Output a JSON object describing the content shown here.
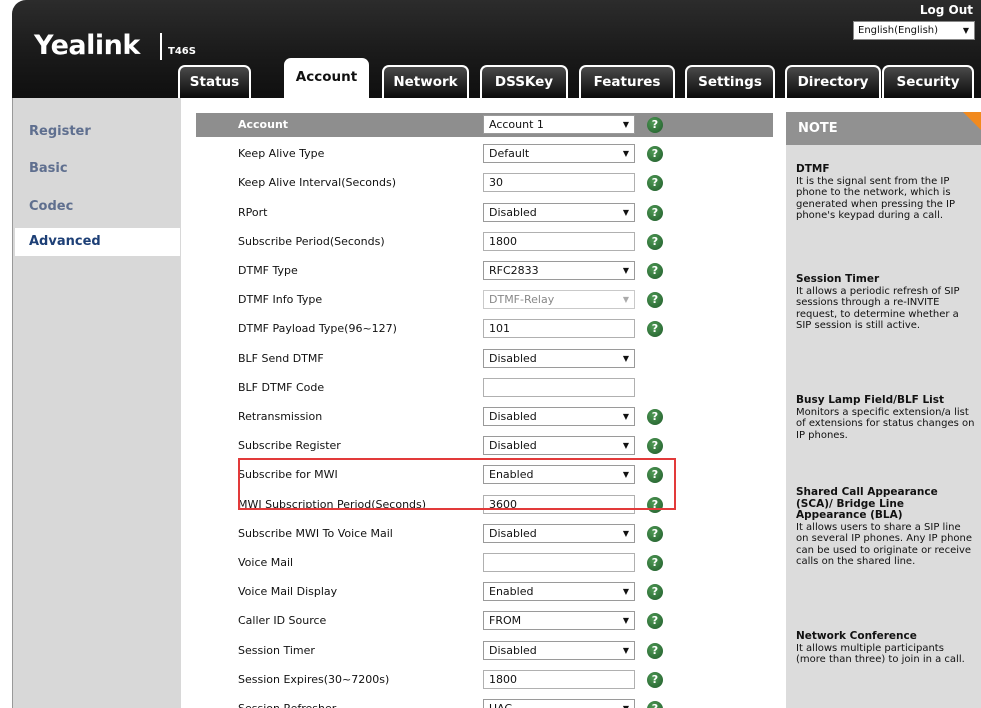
{
  "header": {
    "logo": "Yealink",
    "model": "T46S",
    "logout": "Log Out",
    "language": "English(English)",
    "tabs": [
      "Status",
      "Account",
      "Network",
      "DSSKey",
      "Features",
      "Settings",
      "Directory",
      "Security"
    ],
    "active_tab": "Account"
  },
  "sidebar": {
    "items": [
      "Register",
      "Basic",
      "Codec",
      "Advanced"
    ],
    "active": "Advanced"
  },
  "form": {
    "rows": [
      {
        "label": "Account",
        "type": "select",
        "value": "Account 1",
        "help": true
      },
      {
        "label": "Keep Alive Type",
        "type": "select",
        "value": "Default",
        "help": true
      },
      {
        "label": "Keep Alive Interval(Seconds)",
        "type": "input",
        "value": "30",
        "help": true
      },
      {
        "label": "RPort",
        "type": "select",
        "value": "Disabled",
        "help": true
      },
      {
        "label": "Subscribe Period(Seconds)",
        "type": "input",
        "value": "1800",
        "help": true
      },
      {
        "label": "DTMF Type",
        "type": "select",
        "value": "RFC2833",
        "help": true
      },
      {
        "label": "DTMF Info Type",
        "type": "select",
        "value": "DTMF-Relay",
        "help": true,
        "disabled": true
      },
      {
        "label": "DTMF Payload Type(96~127)",
        "type": "input",
        "value": "101",
        "help": true
      },
      {
        "label": "BLF Send DTMF",
        "type": "select",
        "value": "Disabled",
        "help": false
      },
      {
        "label": "BLF DTMF Code",
        "type": "input",
        "value": "",
        "help": false
      },
      {
        "label": "Retransmission",
        "type": "select",
        "value": "Disabled",
        "help": true
      },
      {
        "label": "Subscribe Register",
        "type": "select",
        "value": "Disabled",
        "help": true
      },
      {
        "label": "Subscribe for MWI",
        "type": "select",
        "value": "Enabled",
        "help": true
      },
      {
        "label": "MWI Subscription Period(Seconds)",
        "type": "input",
        "value": "3600",
        "help": true
      },
      {
        "label": "Subscribe MWI To Voice Mail",
        "type": "select",
        "value": "Disabled",
        "help": true
      },
      {
        "label": "Voice Mail",
        "type": "input",
        "value": "",
        "help": true
      },
      {
        "label": "Voice Mail Display",
        "type": "select",
        "value": "Enabled",
        "help": true
      },
      {
        "label": "Caller ID Source",
        "type": "select",
        "value": "FROM",
        "help": true
      },
      {
        "label": "Session Timer",
        "type": "select",
        "value": "Disabled",
        "help": true
      },
      {
        "label": "Session Expires(30~7200s)",
        "type": "input",
        "value": "1800",
        "help": true
      },
      {
        "label": "Session Refresher",
        "type": "select",
        "value": "UAC",
        "help": true
      }
    ],
    "help_glyph": "?",
    "highlight_color": "#e23a3a"
  },
  "note": {
    "title": "NOTE",
    "accent_color": "#f18a1e",
    "sections": [
      {
        "heading": "DTMF",
        "text": "It is the signal sent from the IP phone to the network, which is generated when pressing the IP phone's keypad during a call."
      },
      {
        "heading": "Session Timer",
        "text": "It allows a periodic refresh of SIP sessions through a re-INVITE request, to determine whether a SIP session is still active."
      },
      {
        "heading": "Busy Lamp Field/BLF List",
        "text": "Monitors a specific extension/a list of extensions for status changes on IP phones."
      },
      {
        "heading": "Shared Call Appearance (SCA)/ Bridge Line Appearance (BLA)",
        "text": "It allows users to share a SIP line on several IP phones. Any IP phone can be used to originate or receive calls on the shared line."
      },
      {
        "heading": "Network Conference",
        "text": "It allows multiple participants (more than three) to join in a call."
      }
    ]
  }
}
